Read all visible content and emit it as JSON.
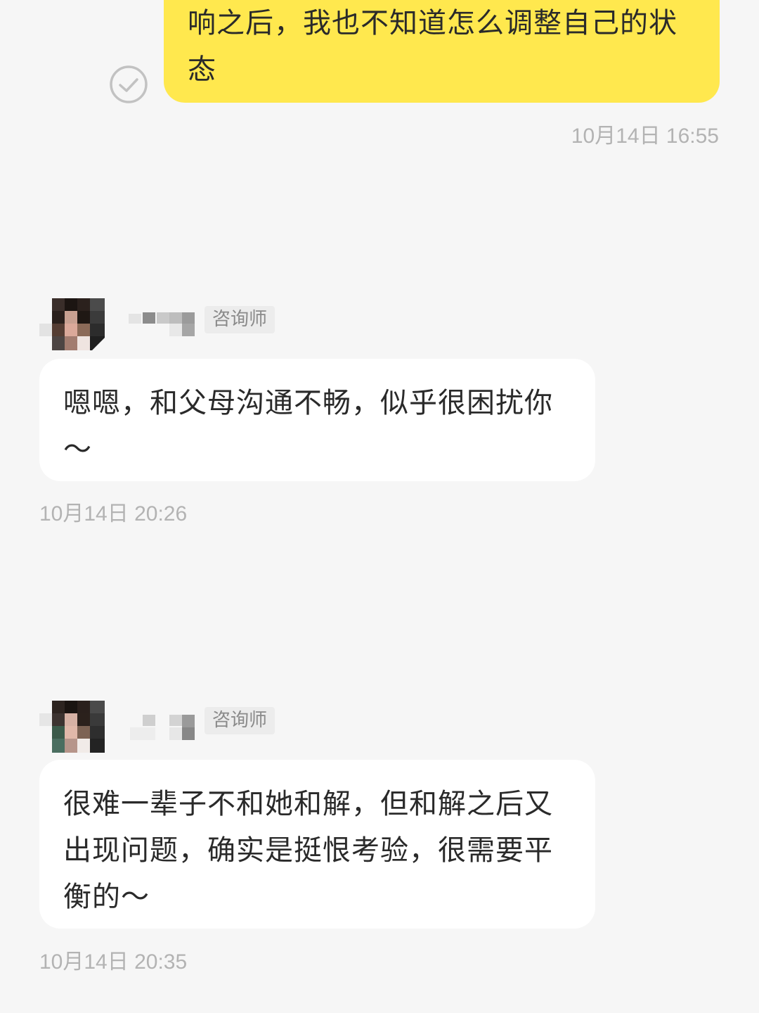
{
  "messages": {
    "outgoing": {
      "text": "响之后，我也不知道怎么调整自己的状态",
      "time": "10月14日 16:55",
      "status_icon": "check-circle-icon"
    },
    "incoming": [
      {
        "role": "咨询师",
        "text": "嗯嗯，和父母沟通不畅，似乎很困扰你～",
        "time": "10月14日 20:26"
      },
      {
        "role": "咨询师",
        "text": "很难一辈子不和她和解，但和解之后又出现问题，确实是挺恨考验，很需要平衡的～",
        "time": "10月14日 20:35"
      }
    ]
  },
  "colors": {
    "background": "#f6f6f6",
    "outgoing_bubble": "#ffe84e",
    "incoming_bubble": "#ffffff",
    "timestamp": "#b3b3b3",
    "badge_bg": "#ececec"
  }
}
